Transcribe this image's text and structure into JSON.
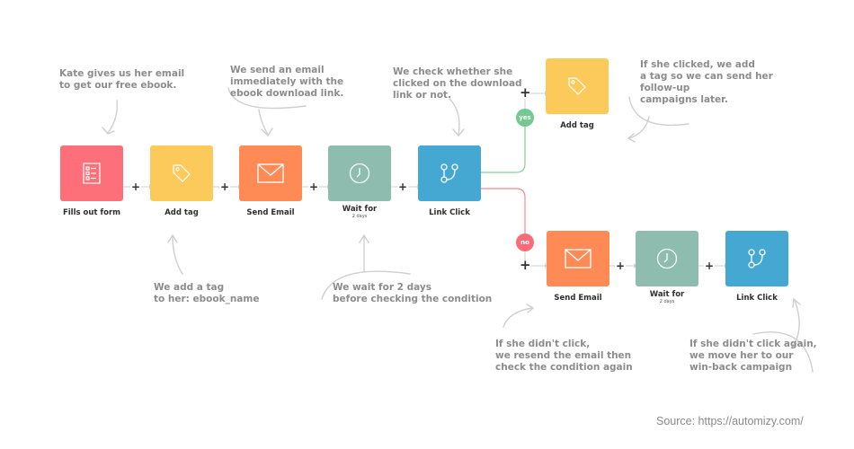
{
  "colors": {
    "form": "#fd6f79",
    "tag": "#fcc95b",
    "email": "#fe8a56",
    "wait": "#8ebcaf",
    "link": "#45a8d2",
    "yes": "#74c891",
    "no": "#f86c78",
    "note_text": "#8c8c8c",
    "arrow": "#cfcfcf"
  },
  "main_flow": [
    {
      "label": "Fills out form",
      "icon": "form-checklist-icon",
      "color_key": "form"
    },
    {
      "label": "Add tag",
      "icon": "tag-icon",
      "color_key": "tag"
    },
    {
      "label": "Send Email",
      "icon": "envelope-icon",
      "color_key": "email"
    },
    {
      "label": "Wait for",
      "sub": "2 days",
      "icon": "clock-icon",
      "color_key": "wait"
    },
    {
      "label": "Link Click",
      "icon": "branch-icon",
      "color_key": "link"
    }
  ],
  "yes_branch": {
    "badge": "yes",
    "nodes": [
      {
        "label": "Add tag",
        "icon": "tag-icon",
        "color_key": "tag"
      }
    ]
  },
  "no_branch": {
    "badge": "no",
    "nodes": [
      {
        "label": "Send Email",
        "icon": "envelope-icon",
        "color_key": "email"
      },
      {
        "label": "Wait for",
        "sub": "2 days",
        "icon": "clock-icon",
        "color_key": "wait"
      },
      {
        "label": "Link Click",
        "icon": "branch-icon",
        "color_key": "link"
      }
    ]
  },
  "plus_symbol": "+",
  "annotations": {
    "form": "Kate gives us her email\nto get our free ebook.",
    "email": "We send an email\nimmediately with the\nebook download link.",
    "check": "We check whether she\nclicked on the download\nlink or not.",
    "yes_tag": "If she clicked, we add\na tag so we can send her\nfollow-up\ncampaigns later.",
    "tag": "We add a tag\nto her: ebook_name",
    "wait": "We wait for 2 days\nbefore checking the condition",
    "resend": "If she didn't click,\nwe resend the email then\ncheck the condition again",
    "winback": "If she didn't click again,\nwe move her to our\nwin-back campaign"
  },
  "source": "Source: https://automizy.com/"
}
